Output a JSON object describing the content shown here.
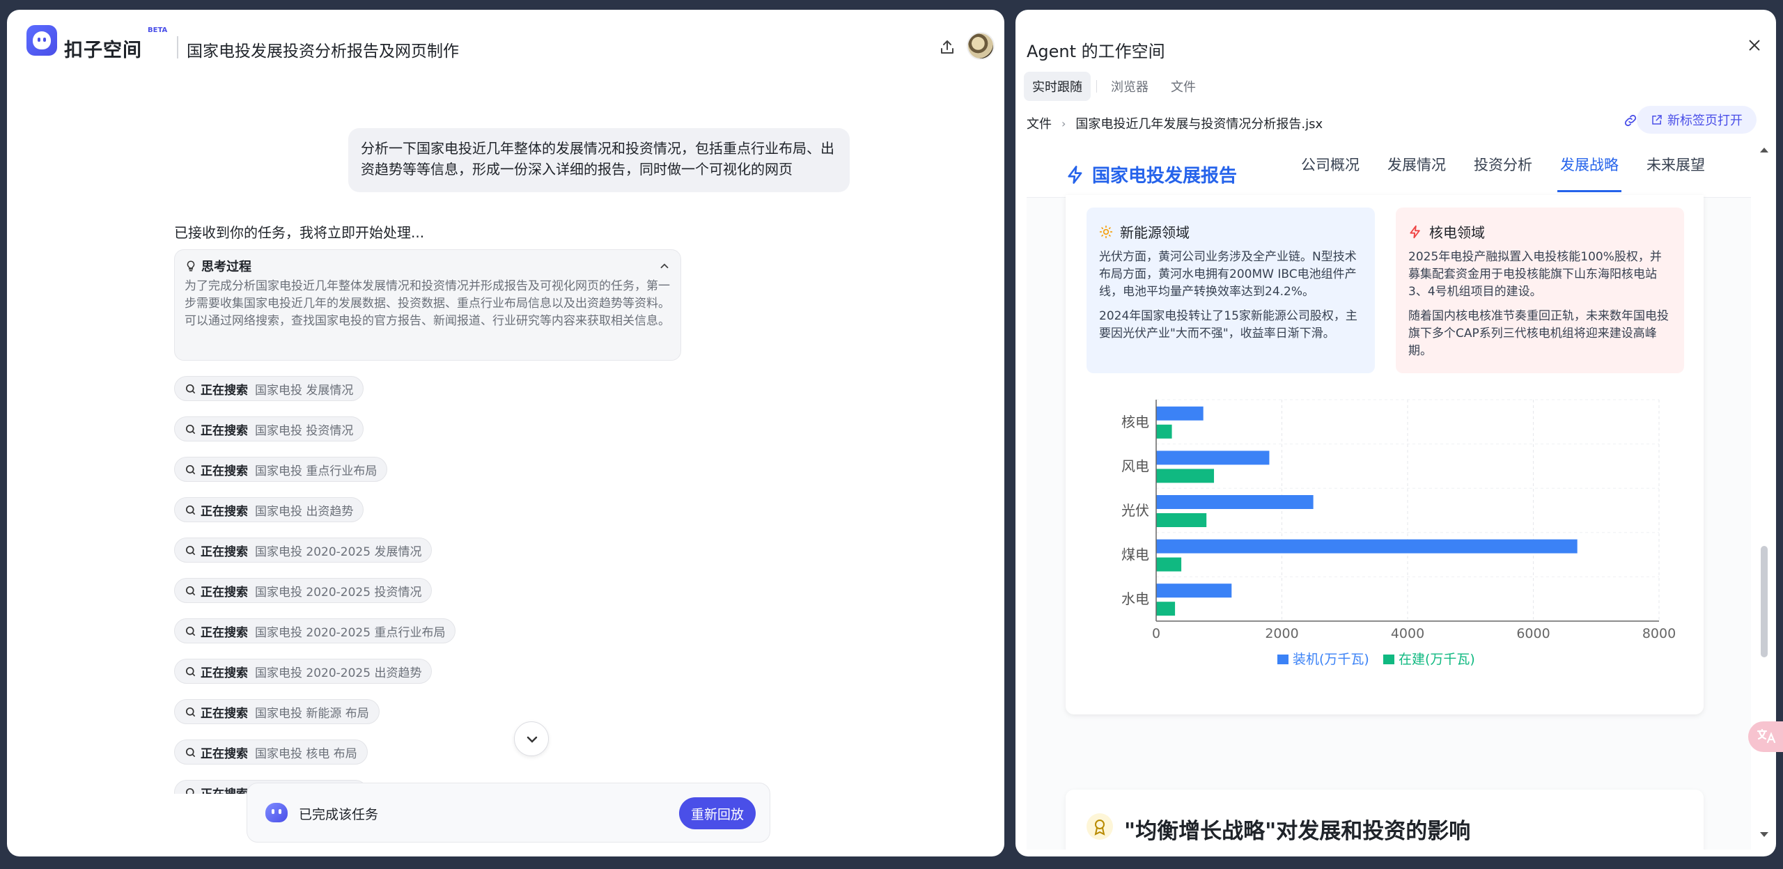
{
  "header": {
    "brand": "扣子空间",
    "beta": "BETA",
    "conversation_title": "国家电投发展投资分析报告及网页制作"
  },
  "chat": {
    "user_message": "分析一下国家电投近几年整体的发展情况和投资情况，包括重点行业布局、出资趋势等等信息，形成一份深入详细的报告，同时做一个可视化的网页",
    "ack": "已接收到你的任务，我将立即开始处理...",
    "thinking": {
      "title": "思考过程",
      "text": "为了完成分析国家电投近几年整体发展情况和投资情况并形成报告及可视化网页的任务，第一步需要收集国家电投近几年的发展数据、投资数据、重点行业布局信息以及出资趋势等资料。可以通过网络搜索，查找国家电投的官方报告、新闻报道、行业研究等内容来获取相关信息。"
    },
    "search_prefix": "正在搜索",
    "searches": [
      "国家电投 发展情况",
      "国家电投 投资情况",
      "国家电投 重点行业布局",
      "国家电投 出资趋势",
      "国家电投 2020-2025 发展情况",
      "国家电投 2020-2025 投资情况",
      "国家电投 2020-2025 重点行业布局",
      "国家电投 2020-2025 出资趋势",
      "国家电投 新能源 布局",
      "国家电投 核电 布局",
      "国家电投 风电 布局"
    ],
    "status_text": "已完成该任务",
    "replay_button": "重新回放"
  },
  "workspace": {
    "title": "Agent 的工作空间",
    "tabs": [
      "实时跟随",
      "浏览器",
      "文件"
    ],
    "active_tab": "实时跟随",
    "breadcrumb_root": "文件",
    "file_name": "国家电投近几年发展与投资情况分析报告.jsx",
    "open_new_tab": "新标签页打开"
  },
  "preview": {
    "logo": "国家电投发展报告",
    "nav": [
      "公司概况",
      "发展情况",
      "投资分析",
      "发展战略",
      "未来展望"
    ],
    "active_nav": "发展战略",
    "new_energy": {
      "title": "新能源领域",
      "p1": "光伏方面，黄河公司业务涉及全产业链。N型技术布局方面，黄河水电拥有200MW IBC电池组件产线，电池平均量产转换效率达到24.2%。",
      "p2": "2024年国家电投转让了15家新能源公司股权，主要因光伏产业\"大而不强\"，收益率日渐下滑。"
    },
    "nuclear": {
      "title": "核电领域",
      "p1": "2025年电投产融拟置入电投核能100%股权，并募集配套资金用于电投核能旗下山东海阳核电站3、4号机组项目的建设。",
      "p2": "随着国内核电核准节奏重回正轨，未来数年国电投旗下多个CAP系列三代核电机组将迎来建设高峰期。"
    },
    "section2_title": "\"均衡增长战略\"对发展和投资的影响"
  },
  "chart_data": {
    "type": "bar",
    "orientation": "horizontal",
    "categories": [
      "核电",
      "风电",
      "光伏",
      "煤电",
      "水电"
    ],
    "series": [
      {
        "name": "装机(万千瓦)",
        "color": "#3b82f6",
        "values": [
          750,
          1800,
          2500,
          6700,
          1200
        ]
      },
      {
        "name": "在建(万千瓦)",
        "color": "#10b981",
        "values": [
          250,
          920,
          800,
          400,
          300
        ]
      }
    ],
    "xlim": [
      0,
      8000
    ],
    "xticks": [
      "0",
      "2000",
      "4000",
      "6000",
      "8000"
    ],
    "grid": true,
    "legend": "bottom"
  },
  "colors": {
    "accent": "#4a4fe8",
    "report_blue": "#2563eb"
  }
}
